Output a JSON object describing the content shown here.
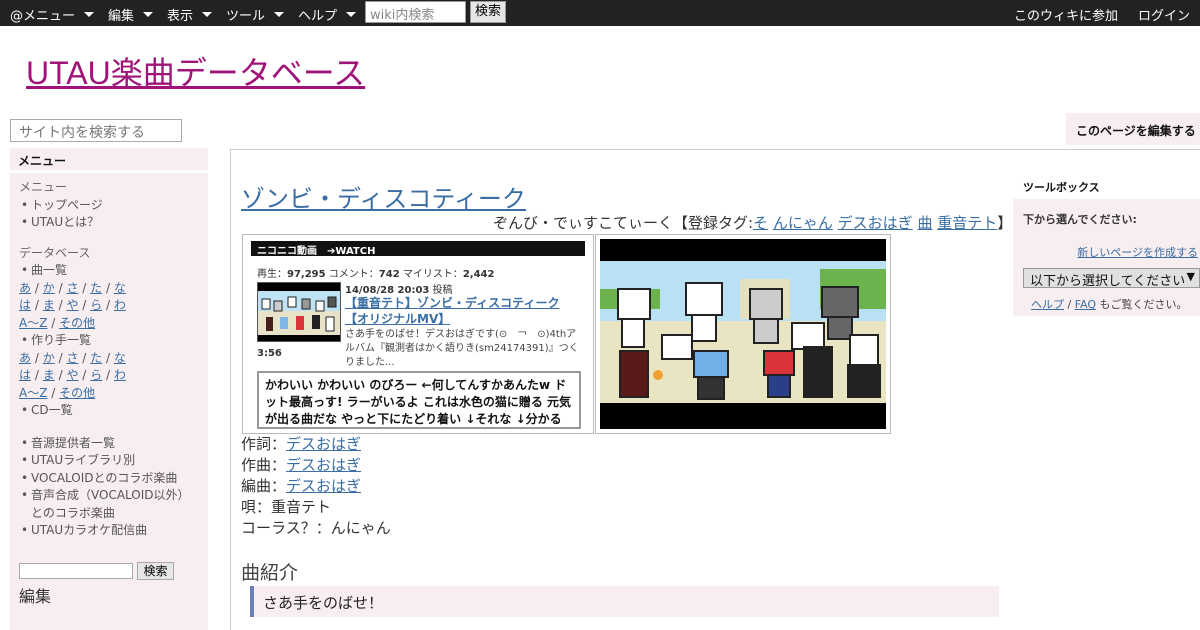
{
  "topbar": {
    "menus": [
      "@メニュー",
      "編集",
      "表示",
      "ツール",
      "ヘルプ"
    ],
    "search_placeholder": "wiki内検索",
    "search_button": "検索",
    "join": "このウィキに参加",
    "login": "ログイン"
  },
  "site_title": "UTAU楽曲データベース",
  "sidebar": {
    "search_placeholder": "サイト内を検索する",
    "menu_head": "メニュー",
    "section_menu": "メニュー",
    "menu_items": [
      "トップページ",
      "UTAUとは？"
    ],
    "section_db": "データベース",
    "song_list": "曲一覧",
    "kana_rows": [
      [
        "あ",
        "か",
        "さ",
        "た",
        "な"
      ],
      [
        "は",
        "ま",
        "や",
        "ら",
        "わ"
      ],
      [
        "A～Z",
        "その他"
      ]
    ],
    "author_list": "作り手一覧",
    "cd_list": "CD一覧",
    "other_items": [
      "音源提供者一覧",
      "UTAUライブラリ別",
      "VOCALOIDとのコラボ楽曲",
      "音声合成（VOCALOID以外）とのコラボ楽曲",
      "UTAUカラオケ配信曲"
    ],
    "mini_search_button": "検索",
    "edit_head": "編集"
  },
  "edit_page_button": "このページを編集する",
  "page": {
    "title": "ゾンビ・ディスコティーク",
    "reading_prefix": "ぞんび・でぃすこてぃーく【登録タグ:",
    "tags": [
      "そ",
      "んにゃん",
      "デスおはぎ",
      "曲",
      "重音テト"
    ],
    "reading_suffix": "】"
  },
  "nico": {
    "brand": "ニコニコ動画　➔WATCH",
    "stats_play_label": "再生：",
    "stats_play": "97,295",
    "stats_comment_label": "コメント：",
    "stats_comment": "742",
    "stats_mylist_label": "マイリスト：",
    "stats_mylist": "2,442",
    "duration": "3:56",
    "posted_date": "14/08/28 20:03",
    "posted_label": "投稿",
    "video_title": "【重音テト】ゾンビ・ディスコティーク【オリジナルMV】",
    "description": "さあ手をのばせ！デスおはぎです(⊙　￢　⊙)4thアルバム『観測者はかく語りき(sm24174391)』つくりました...",
    "comments": "かわいい かわいい のびろー ←何してんすかあんたw ドット最高っす! ラーがいるよ これは水色の猫に贈る 元気が出る曲だな やっと下にたどり着い ↓それな ↓分かる ↓そ"
  },
  "credits": {
    "lyrics_label": "作詞：",
    "lyrics": "デスおはぎ",
    "music_label": "作曲：",
    "music": "デスおはぎ",
    "arrange_label": "編曲：",
    "arrange": "デスおはぎ",
    "vocal": "唄：重音テト",
    "chorus": "コーラス？：んにゃん"
  },
  "intro": {
    "head": "曲紹介",
    "quote": "さあ手をのばせ！"
  },
  "toolbox": {
    "head": "ツールボックス",
    "choose": "下から選んでください:",
    "new_page": "新しいページを作成する",
    "select_value": "以下から選択してください",
    "help_link": "ヘルプ",
    "faq_link": "FAQ",
    "help_suffix": "もご覧ください。"
  }
}
